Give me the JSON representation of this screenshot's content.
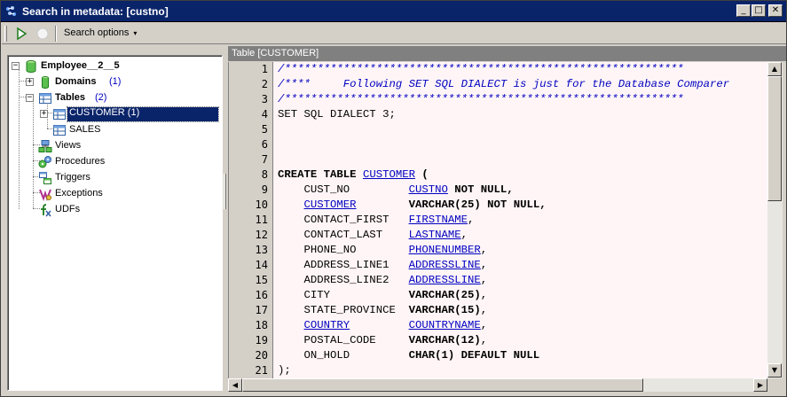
{
  "window": {
    "title": "Search in metadata: [custno]",
    "min_glyph": "_",
    "max_glyph": "□",
    "close_glyph": "✕"
  },
  "toolbar": {
    "search_options_label": "Search options",
    "caret": "▾"
  },
  "tree": {
    "root": {
      "label": "Employee__2__5"
    },
    "domains": {
      "label": "Domains",
      "count": "(1)"
    },
    "tables": {
      "label": "Tables",
      "count": "(2)"
    },
    "customer": {
      "label": "CUSTOMER  (1)"
    },
    "sales": {
      "label": "SALES"
    },
    "views": {
      "label": "Views"
    },
    "procedures": {
      "label": "Procedures"
    },
    "triggers": {
      "label": "Triggers"
    },
    "exceptions": {
      "label": "Exceptions"
    },
    "udfs": {
      "label": "UDFs"
    }
  },
  "editor": {
    "header": "Table [CUSTOMER]",
    "line_numbers": [
      "1",
      "2",
      "3",
      "4",
      "5",
      "6",
      "7",
      "8",
      "9",
      "10",
      "11",
      "12",
      "13",
      "14",
      "15",
      "16",
      "17",
      "18",
      "19",
      "20",
      "21"
    ],
    "lines": {
      "l1": "/*************************************************************",
      "l2": "/****     Following SET SQL DIALECT is just for the Database Comparer",
      "l3": "/*************************************************************",
      "l4": "SET SQL DIALECT 3;",
      "l8a": "CREATE TABLE ",
      "l8b": "CUSTOMER",
      "l8c": " (",
      "l9a": "    CUST_NO         ",
      "l9b": "CUSTNO",
      "l9c": " NOT NULL,",
      "l10a": "    ",
      "l10b": "CUSTOMER",
      "l10c": "        ",
      "l10d": "VARCHAR(25) NOT NULL,",
      "l11a": "    CONTACT_FIRST   ",
      "l11b": "FIRSTNAME",
      "l11c": ",",
      "l12a": "    CONTACT_LAST    ",
      "l12b": "LASTNAME",
      "l12c": ",",
      "l13a": "    PHONE_NO        ",
      "l13b": "PHONENUMBER",
      "l13c": ",",
      "l14a": "    ADDRESS_LINE1   ",
      "l14b": "ADDRESSLINE",
      "l14c": ",",
      "l15a": "    ADDRESS_LINE2   ",
      "l15b": "ADDRESSLINE",
      "l15c": ",",
      "l16a": "    CITY            ",
      "l16b": "VARCHAR(25)",
      "l16c": ",",
      "l17a": "    STATE_PROVINCE  ",
      "l17b": "VARCHAR(15)",
      "l17c": ",",
      "l18a": "    ",
      "l18b": "COUNTRY",
      "l18c": "         ",
      "l18d": "COUNTRYNAME",
      "l18e": ",",
      "l19a": "    POSTAL_CODE     ",
      "l19b": "VARCHAR(12)",
      "l19c": ",",
      "l20a": "    ON_HOLD         ",
      "l20b": "CHAR(1) DEFAULT NULL",
      "l21": ");"
    }
  },
  "scrollbars": {
    "up": "▲",
    "down": "▼",
    "left": "◀",
    "right": "▶"
  }
}
